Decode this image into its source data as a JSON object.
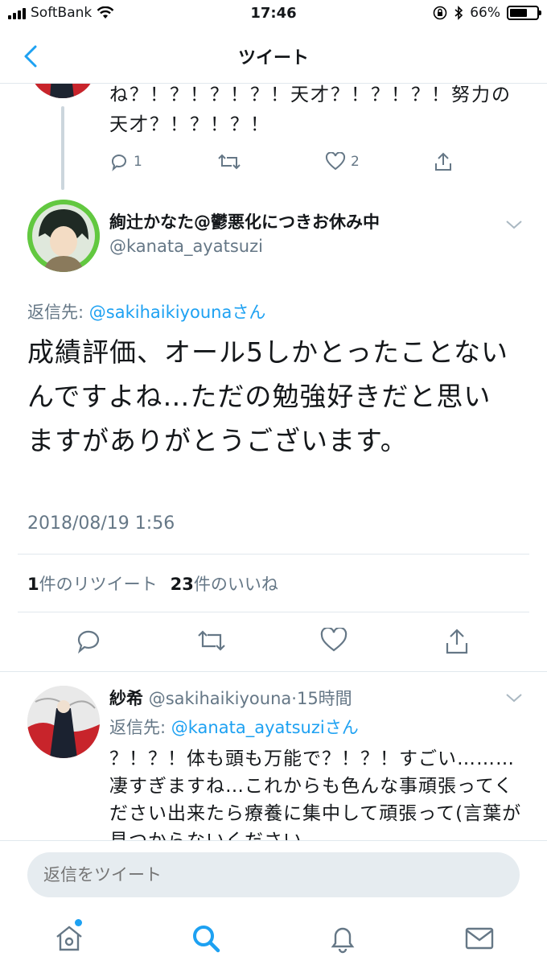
{
  "status_bar": {
    "carrier": "SoftBank",
    "time": "17:46",
    "battery": "66%",
    "battery_level": 0.66
  },
  "nav": {
    "title": "ツイート"
  },
  "previous_tweet": {
    "text": "ね？！？！？！？！天才？！？！？！努力の天才？！？！？！",
    "reply_count": "1",
    "like_count": "2"
  },
  "main_tweet": {
    "display_name": "絢辻かなた@鬱悪化につきお休み中",
    "handle": "@kanata_ayatsuzi",
    "reply_to_prefix": "返信先: ",
    "reply_to_handle": "@sakihaikiyouna",
    "reply_to_suffix": "さん",
    "text": "成績評価、オール5しかとったことないんですよね…ただの勉強好きだと思いますがありがとうございます。",
    "timestamp": "2018/08/19 1:56",
    "retweet_count": "1",
    "retweet_label": "件のリツイート",
    "like_count": "23",
    "like_label": "件のいいね"
  },
  "reply_tweet": {
    "display_name": "紗希",
    "handle": "@sakihaikiyouna",
    "separator": "·",
    "time_ago": "15時間",
    "reply_to_prefix": "返信先: ",
    "reply_to_handle": "@kanata_ayatsuzi",
    "reply_to_suffix": "さん",
    "text": "？！？！体も頭も万能で？！？！すごい………凄すぎますね…これからも色んな事頑張ってください出来たら療養に集中して頑張って(言葉が見つからないください"
  },
  "compose": {
    "placeholder": "返信をツイート"
  },
  "colors": {
    "accent": "#1da1f2",
    "secondary_text": "#657786",
    "divider": "#e1e8ed"
  }
}
